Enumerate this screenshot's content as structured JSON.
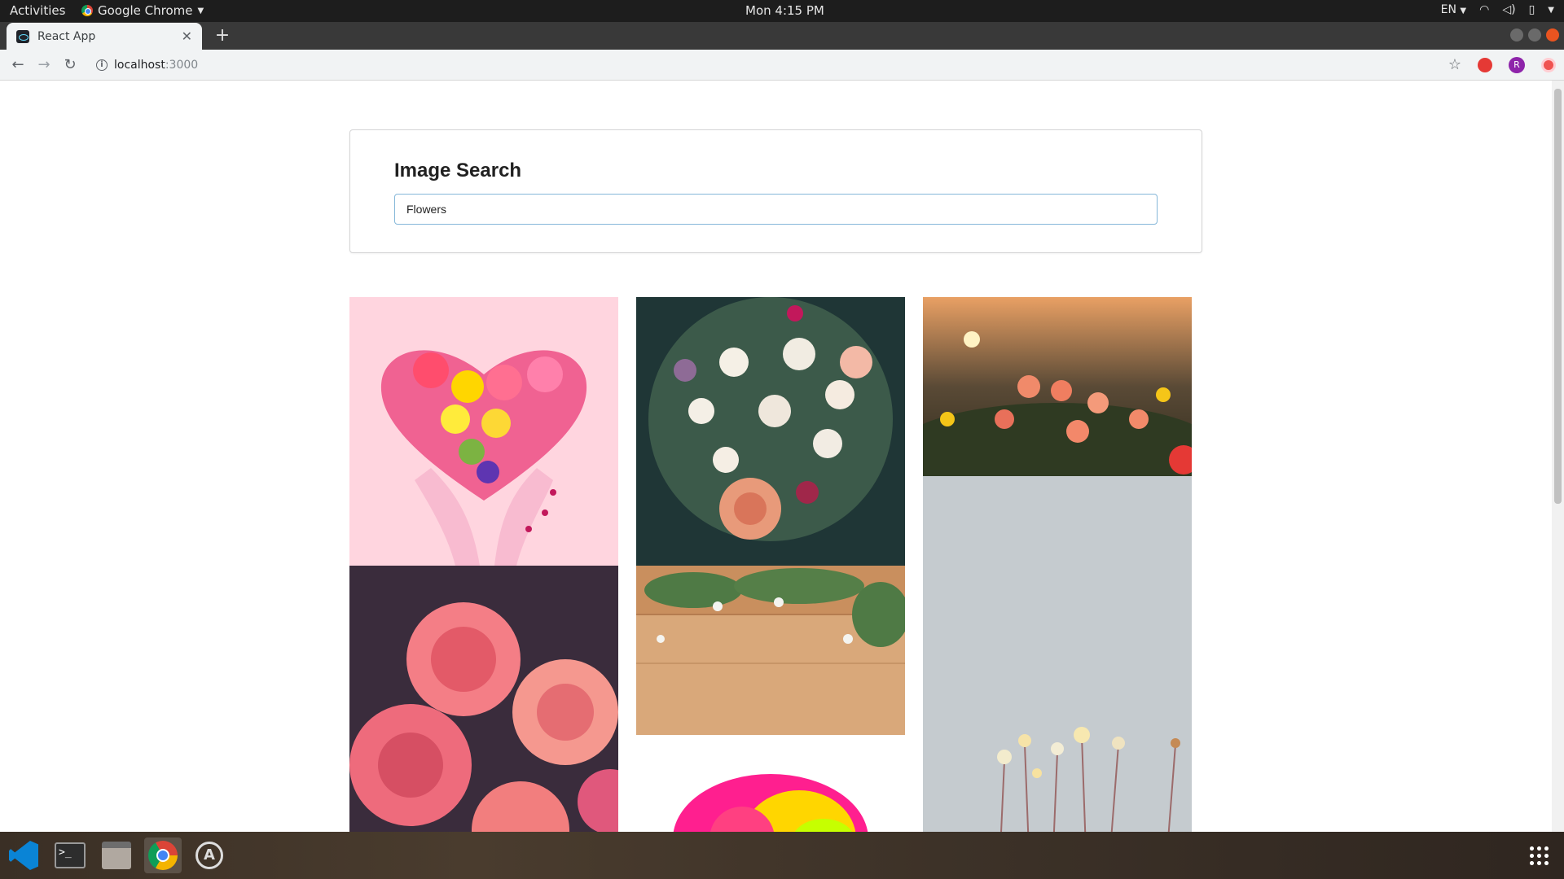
{
  "system": {
    "activities_label": "Activities",
    "app_menu_label": "Google Chrome",
    "clock": "Mon  4:15 PM",
    "keyboard_layout": "EN"
  },
  "browser": {
    "tab_title": "React App",
    "url_host": "localhost",
    "url_port": ":3000",
    "profile_initial": "R"
  },
  "page": {
    "title": "Image Search",
    "search_value": "Flowers",
    "images": [
      {
        "alt": "heart-shaped flower bouquet held by hands",
        "bg": "#ffd5df"
      },
      {
        "alt": "large mixed roses bouquet",
        "bg": "#1f3636"
      },
      {
        "alt": "dahlias at sunset",
        "bg": "#3b3a2a"
      },
      {
        "alt": "pink roses on dark background",
        "bg": "#3a2c3c"
      },
      {
        "alt": "flowers on wooden table",
        "bg": "#d9a87a"
      },
      {
        "alt": "wildflowers on pale background",
        "bg": "#c5cbcf"
      },
      {
        "alt": "rainbow dahlia on white",
        "bg": "#ffffff"
      }
    ]
  },
  "dock": {
    "apps": [
      "vscode",
      "terminal",
      "files",
      "chrome",
      "software-updater"
    ]
  },
  "colors": {
    "ubuntu_orange": "#e95420",
    "input_focus_border": "#85b7d9"
  }
}
